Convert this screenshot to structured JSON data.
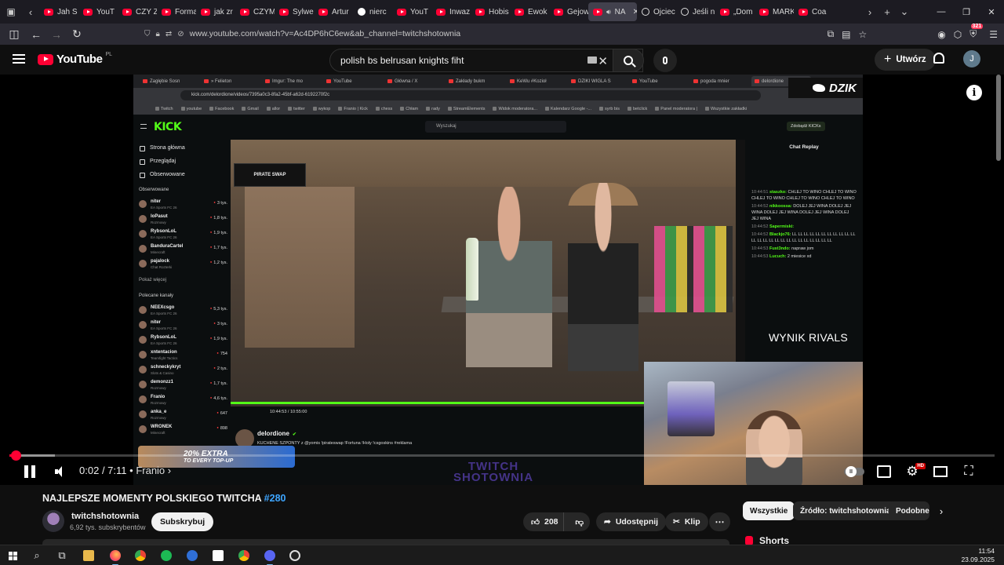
{
  "browser": {
    "tabs": [
      {
        "label": "Jah S",
        "icon": "youtube-icon"
      },
      {
        "label": "YouT",
        "icon": "youtube-icon"
      },
      {
        "label": "CZY Z",
        "icon": "youtube-icon"
      },
      {
        "label": "Forma",
        "icon": "youtube-icon"
      },
      {
        "label": "jak zr",
        "icon": "youtube-icon"
      },
      {
        "label": "CZYM",
        "icon": "youtube-icon"
      },
      {
        "label": "Sylwe",
        "icon": "youtube-icon"
      },
      {
        "label": "Artur",
        "icon": "youtube-icon"
      },
      {
        "label": "nierc",
        "icon": "google-icon"
      },
      {
        "label": "YouT",
        "icon": "youtube-icon"
      },
      {
        "label": "Inwaz",
        "icon": "youtube-icon"
      },
      {
        "label": "Hobis",
        "icon": "youtube-icon"
      },
      {
        "label": "Ewok",
        "icon": "youtube-icon"
      },
      {
        "label": "Gejow",
        "icon": "youtube-icon"
      },
      {
        "label": "NA",
        "icon": "youtube-icon",
        "active": true
      },
      {
        "label": "Ojciec",
        "icon": "sound-icon"
      },
      {
        "label": "Jeśli n",
        "icon": "sound-icon"
      },
      {
        "label": "„Dom",
        "icon": "youtube-icon"
      },
      {
        "label": "MARK",
        "icon": "youtube-icon"
      },
      {
        "label": "Coa",
        "icon": "youtube-icon"
      }
    ],
    "url": "www.youtube.com/watch?v=Ac4DP6hC6ew&ab_channel=twitchshotownia",
    "extension_badge": "321"
  },
  "masthead": {
    "logo_text": "YouTube",
    "country_code": "PL",
    "search_value": "polish bs belrusan knights fiht",
    "create_label": "Utwórz",
    "avatar_letter": "J"
  },
  "player": {
    "current_time": "0:02",
    "duration": "7:11",
    "chapter": "Franio",
    "progress_fraction": 0.003,
    "hd_badge": "HD"
  },
  "inner_video": {
    "inner_tabs": [
      "Zagłębie Sosn",
      "» Felieton",
      "Imgur: The mo",
      "YouTube",
      "Główna / X",
      "Zakłady bukm",
      "KeWu #Kozioł",
      "DZIKI WIGLA S",
      "YouTube",
      "pogoda mnier",
      "delordione"
    ],
    "inner_url": "kick.com/delordione/videos/7395a0c3-8fa2-45bf-a62d-6192270f2c",
    "bookmarks": [
      "Twitch",
      "youtube",
      "Facebook",
      "Gmail",
      "allor",
      "twitter",
      "wykop",
      "Franio | Kick",
      "chess",
      "Chłam",
      "rady",
      "StreamElements",
      "Widok moderatora...",
      "Kalendarz Google -...",
      "syrb bis",
      "betclick",
      "Panel moderatora |",
      "Wszystkie zakładki"
    ],
    "kick_logo": "KICK",
    "search_placeholder": "Wyszukaj",
    "get_kicks": "Zdobądź KICKs",
    "nav": [
      "Strona główna",
      "Przeglądaj",
      "Obserwowane"
    ],
    "followed_header": "Obserwowane",
    "followed": [
      {
        "name": "niter",
        "game": "EA Sports FC 26",
        "viewers": "3 tys."
      },
      {
        "name": "loPasut",
        "game": "Rozmowy",
        "viewers": "1,8 tys."
      },
      {
        "name": "RybsonLoL",
        "game": "EA Sports FC 26",
        "viewers": "1,9 tys."
      },
      {
        "name": "BanduraCartel",
        "game": "Minecraft",
        "viewers": "1,7 tys."
      },
      {
        "name": "pajalock",
        "game": "Chat Rozterki",
        "viewers": "1,2 tys."
      }
    ],
    "show_more": "Pokaż więcej",
    "recommended_header": "Polecane kanały",
    "recommended": [
      {
        "name": "NEEXcsgo",
        "game": "EA Sports FC 26",
        "viewers": "5,3 tys."
      },
      {
        "name": "niter",
        "game": "EA Sports FC 26",
        "viewers": "3 tys."
      },
      {
        "name": "RybsonLoL",
        "game": "EA Sports FC 26",
        "viewers": "1,9 tys."
      },
      {
        "name": "xntentacion",
        "game": "Teamfight Tactics",
        "viewers": "754"
      },
      {
        "name": "schnecky​kryt",
        "game": "Slots & Casino",
        "viewers": "2 tys."
      },
      {
        "name": "demonzz1",
        "game": "Rozmowy",
        "viewers": "1,7 tys."
      },
      {
        "name": "Franio",
        "game": "Rozmowy",
        "viewers": "4,6 tys."
      },
      {
        "name": "anka_e",
        "game": "Rozmowy",
        "viewers": "647"
      },
      {
        "name": "WRONEK",
        "game": "Minecraft",
        "viewers": "898"
      }
    ],
    "sponsor_label": "PIRATE SWAP",
    "video_time": "10:44:53 / 10:55:00",
    "streamer": "delordione",
    "stream_title": "KUCHENE SZPONTY z @yomis !pirateswap !Fortuna !Holy !csgoskins #reklama",
    "chat_header": "Chat Replay",
    "chat": [
      {
        "time": "10:44:51",
        "user": "staszko:",
        "text": "CHLEJ TO WINO CHLEJ TO WINO CHLEJ TO WINO CHLEJ TO WINO CHLEJ TO WINO"
      },
      {
        "time": "10:44:52",
        "user": "nikkoossa:",
        "text": "DOLEJ JEJ WINA DOLEJ JEJ WINA DOLEJ JEJ WINA DOLEJ JEJ WINA DOLEJ JEJ WINA"
      },
      {
        "time": "10:44:52",
        "user": "Sapermiski:",
        "text": ""
      },
      {
        "time": "10:44:52",
        "user": "Blackjo76:",
        "text": "LL LL LL LL LL LL LL LL LL LL LL LL LL LL LL LL LL LL LL LL LL LL LL LL LL"
      },
      {
        "time": "10:44:53",
        "user": "Fust3ndo:",
        "text": "napraw jom"
      },
      {
        "time": "10:44:53",
        "user": "Lucuch:",
        "text": "2 miesice xd"
      }
    ],
    "overlay_logo": "DZIK",
    "overlay_text": "WYNIK RIVALS",
    "promo_main": "20% EXTRA",
    "promo_sub": "TO EVERY TOP-UP",
    "watermark_top": "TWITCH",
    "watermark_bottom": "SHOTOWNIA"
  },
  "video": {
    "title": "NAJLEPSZE MOMENTY POLSKIEGO TWITCHA",
    "title_tag": "#280",
    "channel_name": "twitchshotownia",
    "channel_subs": "6,92 tys. subskrybentów",
    "subscribe_label": "Subskrybuj",
    "likes": "208",
    "share_label": "Udostępnij",
    "clip_label": "Klip",
    "more_label": "⋯"
  },
  "chips": {
    "items": [
      "Wszystkie",
      "Źródło: twitchshotownia",
      "Podobne"
    ],
    "selected": "Wszystkie"
  },
  "shorts_label": "Shorts",
  "taskbar": {
    "time": "11:54",
    "date": "23.09.2025",
    "apps": [
      "start",
      "search",
      "task-view",
      "file-explorer",
      "firefox",
      "chrome",
      "spotify",
      "app-blue",
      "app-kick",
      "chrome-2",
      "discord",
      "obs"
    ]
  },
  "colors": {
    "youtube_red": "#ff0033",
    "kick_green": "#53fc18",
    "link_blue": "#3ea6ff",
    "background": "#0f0f0f"
  }
}
